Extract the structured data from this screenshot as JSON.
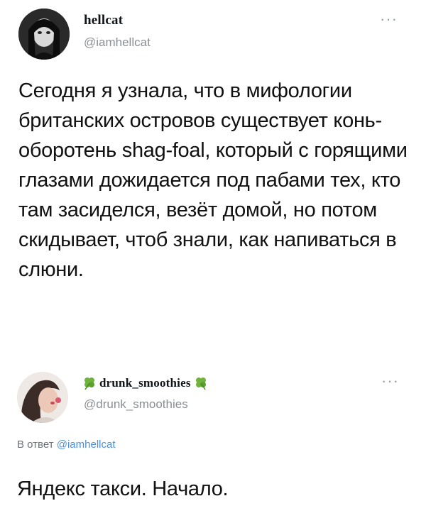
{
  "tweets": [
    {
      "name": "hellcat",
      "handle": "@iamhellcat",
      "more": "···",
      "text": "Сегодня я узнала, что в мифологии британских островов существует конь-оборотень shag-foal, который с горящими глазами дожидается под пабами тех, кто там засиделся, везёт домой, но потом скидывает, чтоб знали, как напиваться в слюни."
    },
    {
      "name": "drunk_smoothies",
      "name_decoration_icon": "clover-emoji",
      "handle": "@drunk_smoothies",
      "more": "···",
      "reply_prefix": "В ответ",
      "reply_mention": "@iamhellcat",
      "text": "Яндекс такси. Начало."
    }
  ],
  "colors": {
    "name": "#0f1419",
    "handle": "#8a8f94",
    "mention": "#4d8fd6",
    "clover": "#6fb23d"
  }
}
